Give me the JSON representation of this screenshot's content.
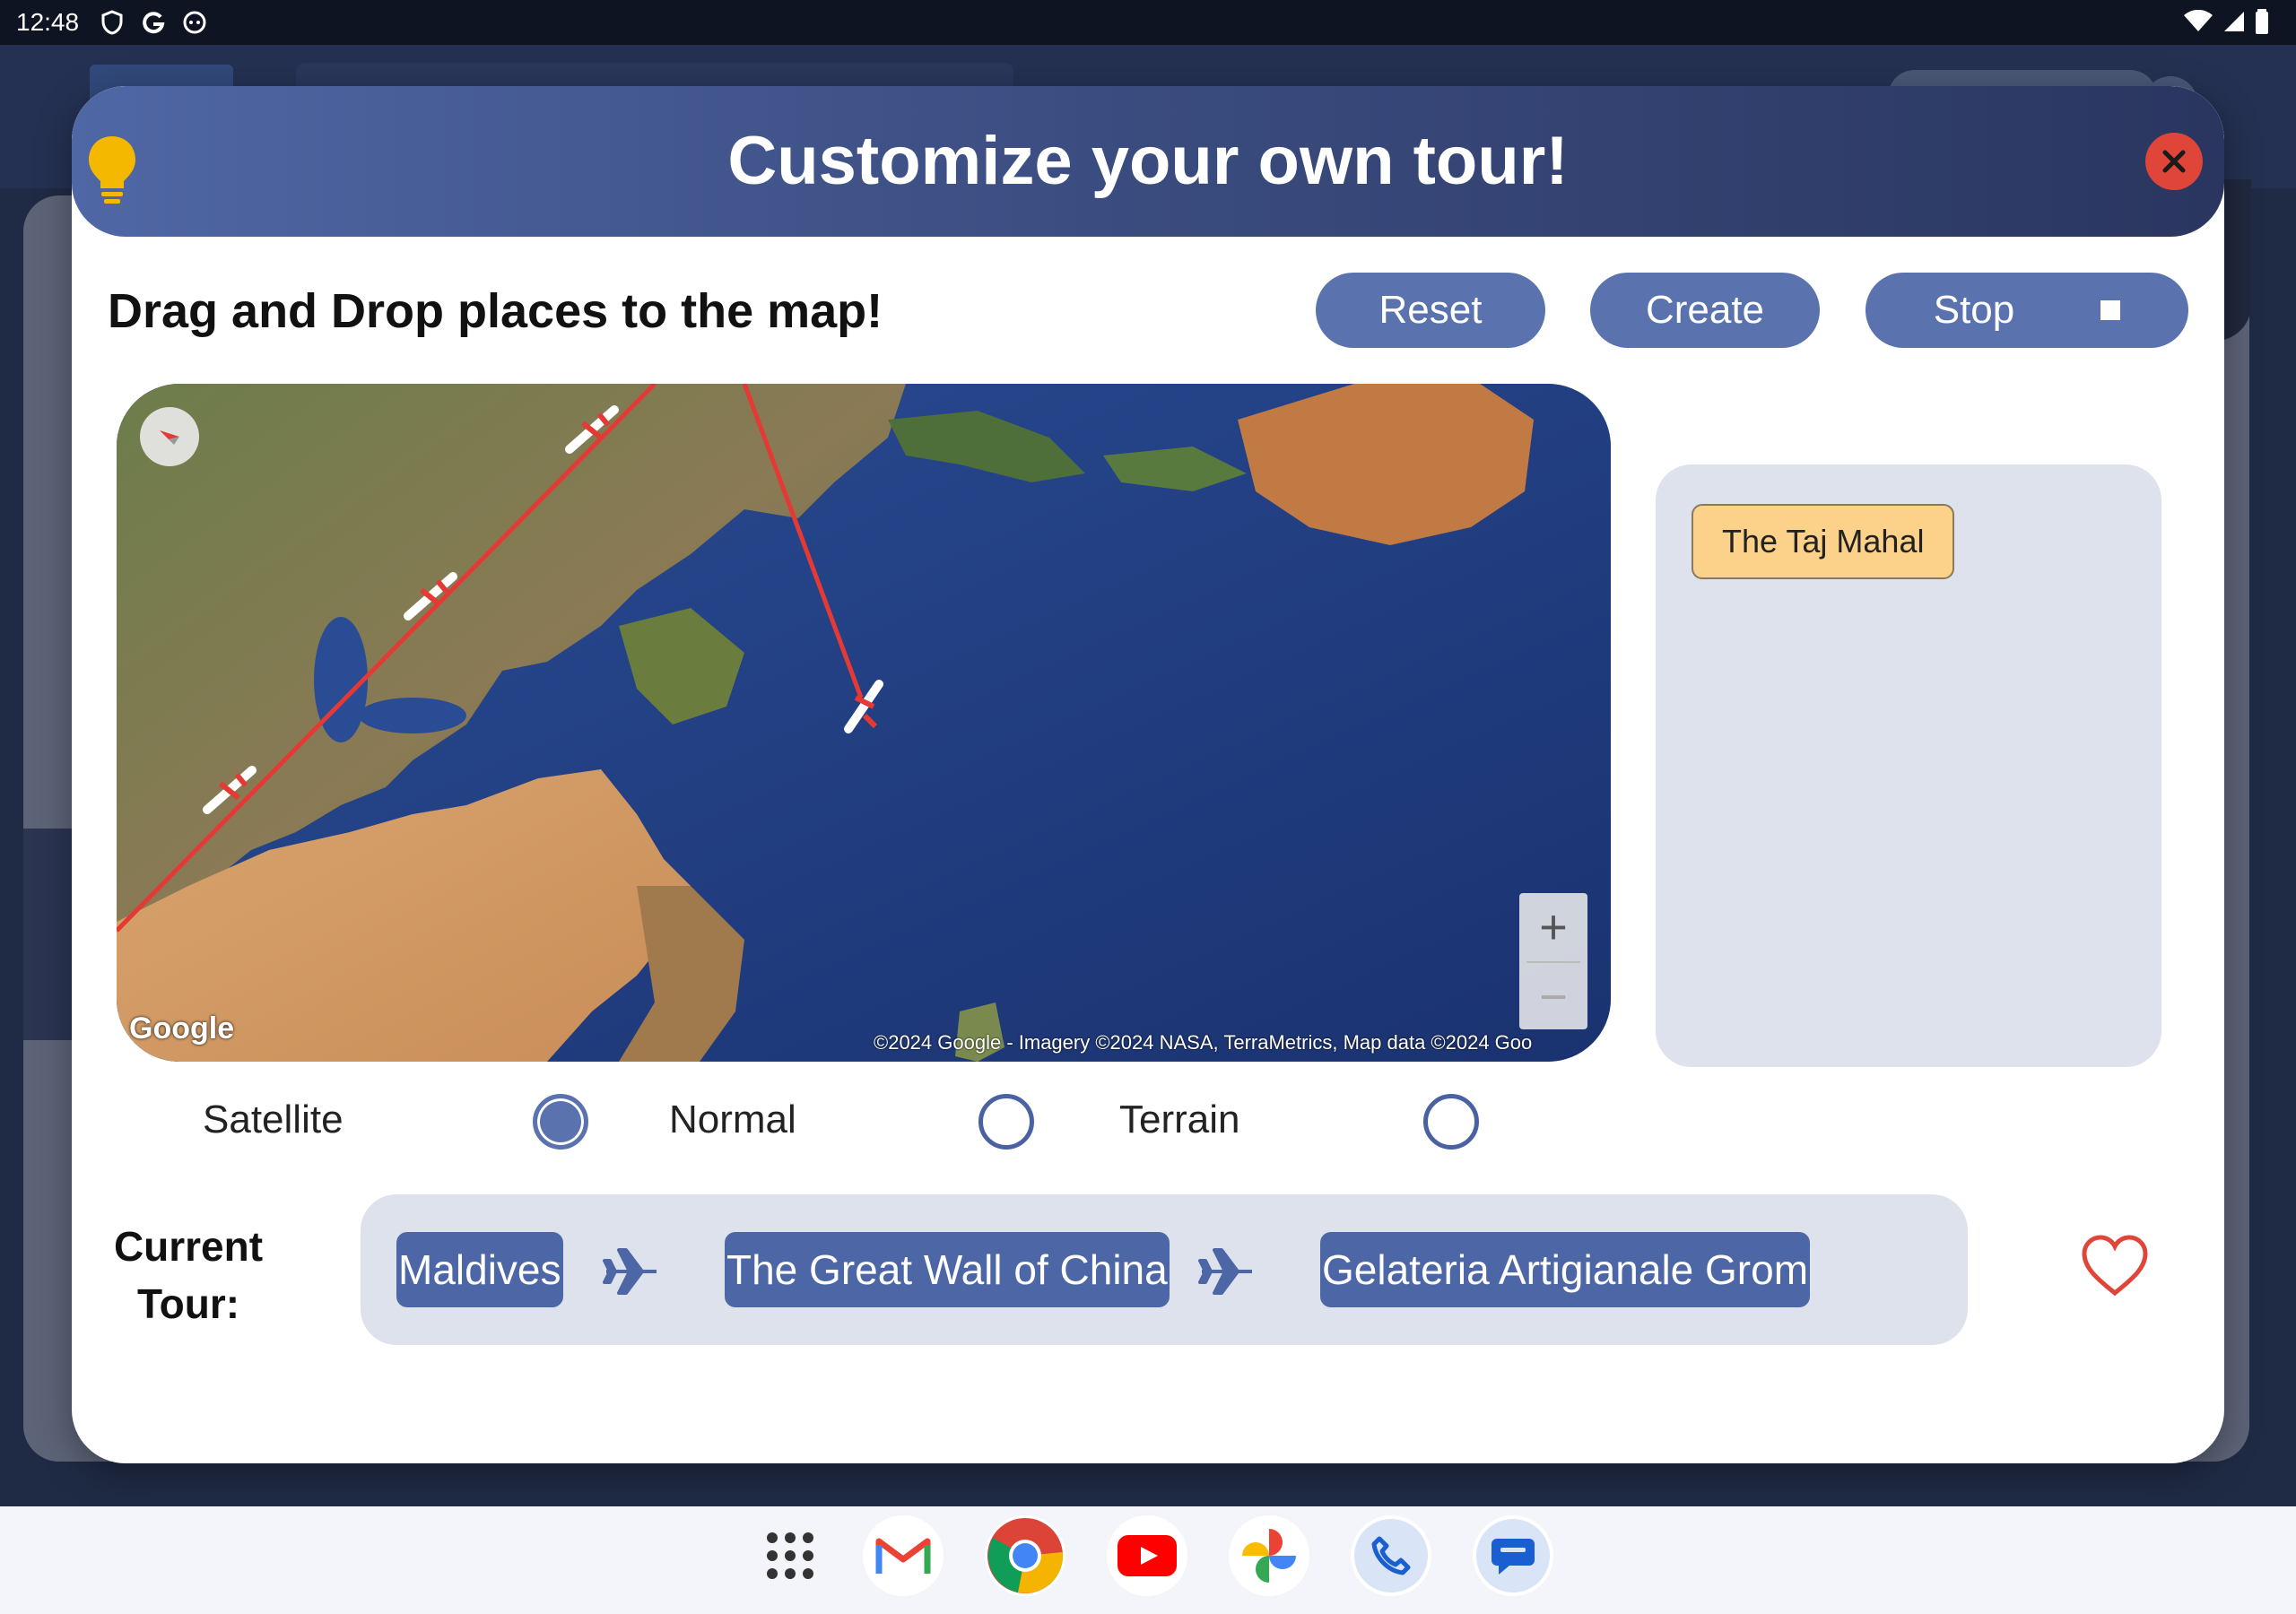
{
  "status_bar": {
    "time": "12:48"
  },
  "dialog": {
    "title": "Customize your own tour!",
    "instruction": "Drag and Drop places to the map!",
    "buttons": {
      "reset": "Reset",
      "create": "Create",
      "stop": "Stop"
    }
  },
  "map": {
    "logo_text": "Google",
    "attribution": "©2024 Google - Imagery ©2024 NASA, TerraMetrics, Map data ©2024 Goo",
    "zoom_in": "+",
    "zoom_out": "−"
  },
  "palette": {
    "places": [
      "The Taj Mahal"
    ]
  },
  "map_types": {
    "options": [
      {
        "label": "Satellite",
        "selected": true
      },
      {
        "label": "Normal",
        "selected": false
      },
      {
        "label": "Terrain",
        "selected": false
      }
    ]
  },
  "tour": {
    "label_line1": "Current",
    "label_line2": "Tour:",
    "stops": [
      "Maldives",
      "The Great Wall of China",
      "Gelateria Artigianale Grom"
    ]
  },
  "colors": {
    "accent": "#5a72ad",
    "chip_place": "#fcd28a",
    "close": "#e0453a",
    "route": "#e53935",
    "panel": "#dde2ed"
  },
  "dock": {
    "apps": [
      "app-drawer-icon",
      "gmail-icon",
      "chrome-icon",
      "youtube-icon",
      "photos-icon",
      "phone-icon",
      "messages-icon"
    ]
  }
}
